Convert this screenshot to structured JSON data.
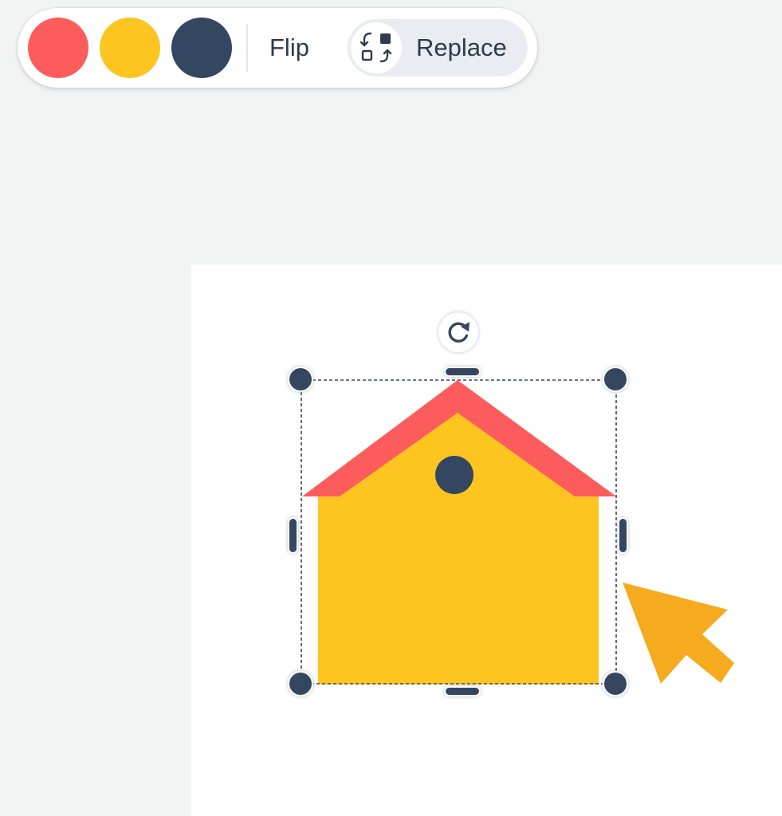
{
  "toolbar": {
    "colors": [
      {
        "name": "coral",
        "hex": "#fd5c5c"
      },
      {
        "name": "yellow",
        "hex": "#fec520"
      },
      {
        "name": "navy",
        "hex": "#344760"
      }
    ],
    "flip_label": "Flip",
    "replace_label": "Replace",
    "replace_icon": "swap-replace-icon"
  },
  "canvas": {
    "selected_shape": "house",
    "rotate_icon": "rotate-icon",
    "cursor_icon": "arrow-cursor-icon",
    "colors": {
      "roof": "#fd5c5c",
      "body": "#fec520",
      "window": "#344760",
      "handles": "#344760",
      "cursor": "#f5ab1d"
    }
  }
}
